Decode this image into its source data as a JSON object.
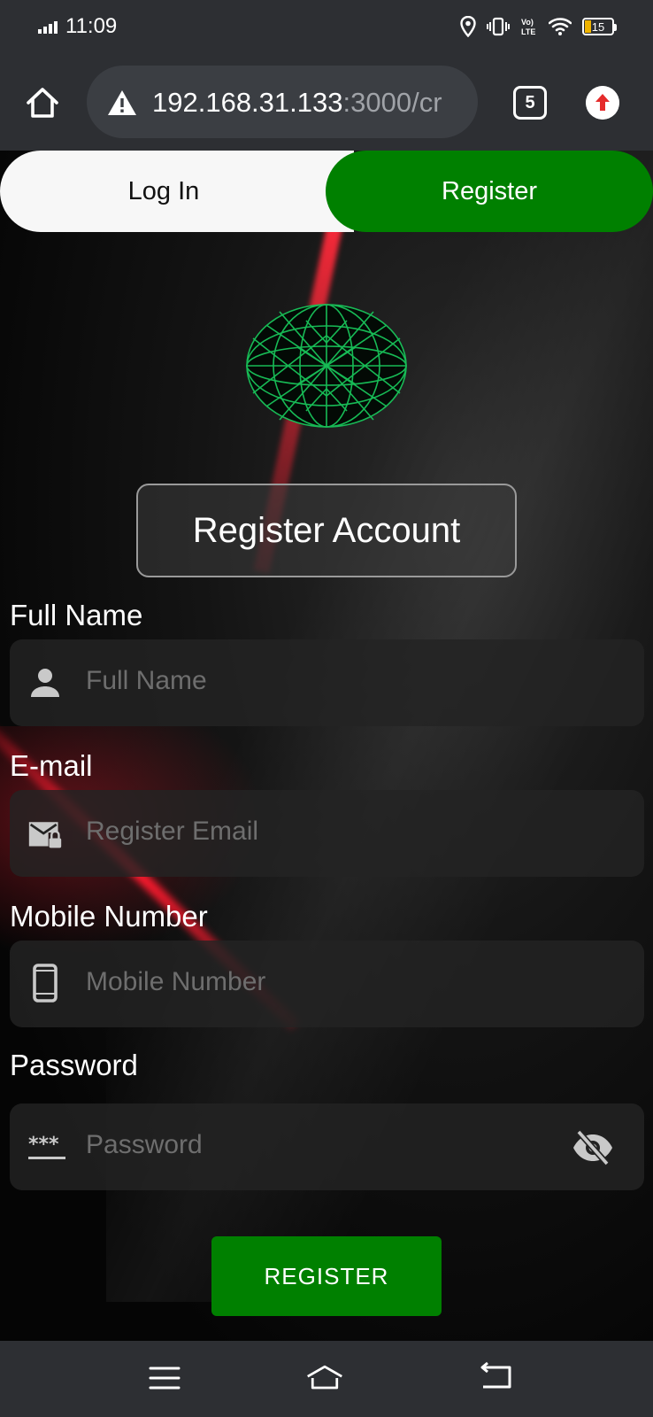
{
  "status_bar": {
    "time": "11:09",
    "battery_level": "15",
    "network_label": "Vo) LTE"
  },
  "browser": {
    "url_host": "192.168.31.133",
    "url_rest": ":3000/cr",
    "tab_count": "5"
  },
  "auth_toggle": {
    "login_label": "Log In",
    "register_label": "Register",
    "active": "Register"
  },
  "page": {
    "title": "Register Account"
  },
  "form": {
    "full_name": {
      "label": "Full Name",
      "placeholder": "Full Name",
      "icon": "person-icon"
    },
    "email": {
      "label": "E-mail",
      "placeholder": "Register Email",
      "icon": "email-lock-icon"
    },
    "mobile": {
      "label": "Mobile Number",
      "placeholder": "Mobile Number",
      "icon": "smartphone-icon"
    },
    "password": {
      "label": "Password",
      "placeholder": "Password",
      "icon": "password-icon",
      "toggle_icon": "visibility-off-icon"
    },
    "submit_label": "REGISTER"
  },
  "colors": {
    "accent_green": "#008000",
    "chrome_bg": "#2d2f33",
    "field_bg": "#232323"
  }
}
